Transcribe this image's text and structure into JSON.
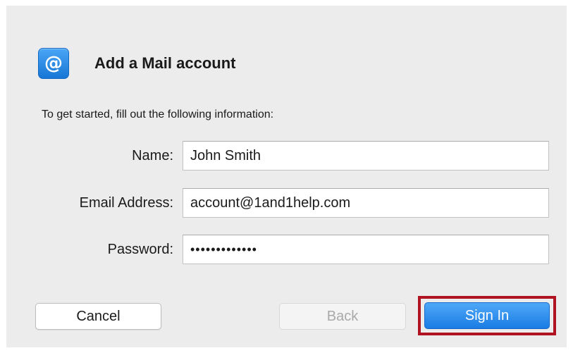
{
  "dialog": {
    "title": "Add a Mail account",
    "icon": "at-sign-icon",
    "intro": "To get started, fill out the following information:"
  },
  "form": {
    "name_label": "Name:",
    "name_value": "John Smith",
    "email_label": "Email Address:",
    "email_value": "account@1and1help.com",
    "password_label": "Password:",
    "password_value": "•••••••••••••"
  },
  "buttons": {
    "cancel": "Cancel",
    "back": "Back",
    "sign_in": "Sign In"
  },
  "colors": {
    "accent": "#1a7ce4",
    "highlight": "#b01423",
    "background": "#ececec"
  }
}
